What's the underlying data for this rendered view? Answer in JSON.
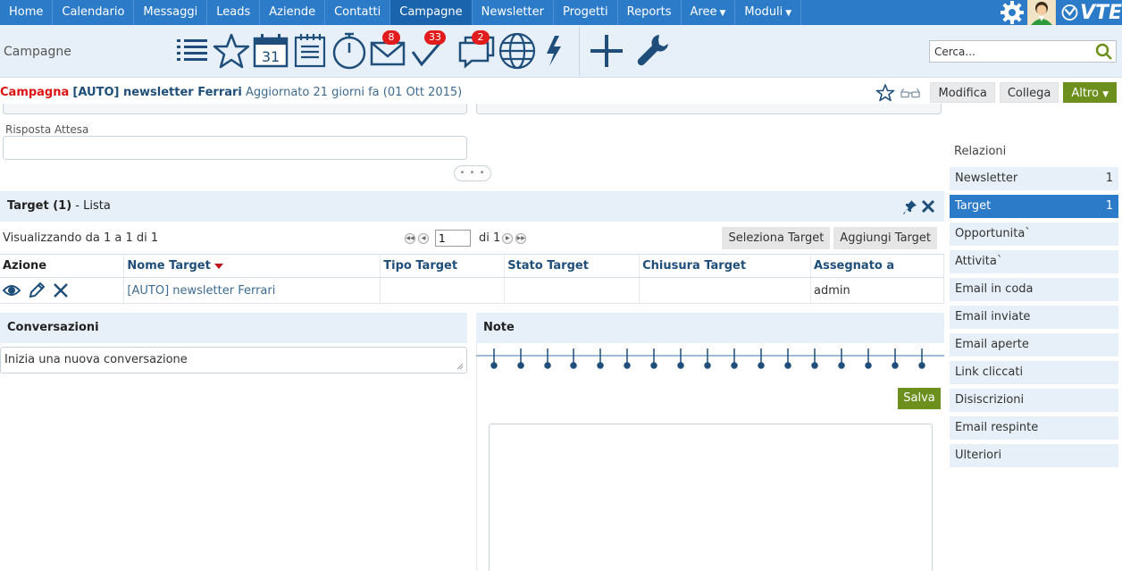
{
  "nav": {
    "items": [
      {
        "label": "Home",
        "active": false,
        "caret": false
      },
      {
        "label": "Calendario",
        "active": false,
        "caret": false
      },
      {
        "label": "Messaggi",
        "active": false,
        "caret": false
      },
      {
        "label": "Leads",
        "active": false,
        "caret": false
      },
      {
        "label": "Aziende",
        "active": false,
        "caret": false
      },
      {
        "label": "Contatti",
        "active": false,
        "caret": false
      },
      {
        "label": "Campagne",
        "active": true,
        "caret": false
      },
      {
        "label": "Newsletter",
        "active": false,
        "caret": false
      },
      {
        "label": "Progetti",
        "active": false,
        "caret": false
      },
      {
        "label": "Reports",
        "active": false,
        "caret": false
      },
      {
        "label": "Aree",
        "active": false,
        "caret": true
      },
      {
        "label": "Moduli",
        "active": false,
        "caret": true
      }
    ],
    "logo_text": "VTE",
    "right_icons": [
      "gear-icon",
      "user-avatar-icon",
      "vte-logo-icon"
    ]
  },
  "toolbar": {
    "module_name": "Campagne",
    "icons": [
      {
        "name": "list-icon",
        "badge": ""
      },
      {
        "name": "favorites-star-icon",
        "badge": ""
      },
      {
        "name": "calendar-icon",
        "badge": "",
        "text": "31"
      },
      {
        "name": "notebook-icon",
        "badge": ""
      },
      {
        "name": "stopwatch-icon",
        "badge": ""
      },
      {
        "name": "mail-icon",
        "badge": "8"
      },
      {
        "name": "todo-check-icon",
        "badge": "33"
      },
      {
        "name": "chat-icon",
        "badge": "2"
      },
      {
        "name": "globe-icon",
        "badge": ""
      },
      {
        "name": "lightning-icon",
        "badge": ""
      },
      {
        "name": "add-plus-icon",
        "badge": ""
      },
      {
        "name": "wrench-icon",
        "badge": ""
      }
    ],
    "search_placeholder": "Cerca..."
  },
  "record": {
    "module": "Campagna",
    "name": "[AUTO] newsletter Ferrari",
    "updated": "Aggiornato 21 giorni fa (01 Ott 2015)",
    "buttons": {
      "modifica": "Modifica",
      "collega": "Collega",
      "altro": "Altro"
    }
  },
  "form": {
    "risposta_label": "Risposta Attesa",
    "risposta_value": ""
  },
  "target_block": {
    "title_bold": "Target (1)",
    "title_rest": " - Lista",
    "visualizzando": "Visualizzando da 1 a 1 di 1",
    "page_value": "1",
    "page_of": "di 1",
    "btn_seleziona": "Seleziona Target",
    "btn_aggiungi": "Aggiungi Target",
    "columns": [
      "Azione",
      "Nome Target",
      "Tipo Target",
      "Stato Target",
      "Chiusura Target",
      "Assegnato a"
    ],
    "rows": [
      {
        "nome": "[AUTO] newsletter Ferrari",
        "tipo": "",
        "stato": "",
        "chiusura": "",
        "assegnato": "admin"
      }
    ]
  },
  "conversazioni": {
    "title": "Conversazioni",
    "placeholder": "Inizia una nuova conversazione"
  },
  "note": {
    "title": "Note",
    "save_label": "Salva"
  },
  "related": {
    "title": "Relazioni",
    "items": [
      {
        "label": "Newsletter",
        "count": "1",
        "active": false
      },
      {
        "label": "Target",
        "count": "1",
        "active": true
      },
      {
        "label": "Opportunita`",
        "count": "",
        "active": false
      },
      {
        "label": "Attivita`",
        "count": "",
        "active": false
      },
      {
        "label": "Email in coda",
        "count": "",
        "active": false
      },
      {
        "label": "Email inviate",
        "count": "",
        "active": false
      },
      {
        "label": "Email aperte",
        "count": "",
        "active": false
      },
      {
        "label": "Link cliccati",
        "count": "",
        "active": false
      },
      {
        "label": "Disiscrizioni",
        "count": "",
        "active": false
      },
      {
        "label": "Email respinte",
        "count": "",
        "active": false
      },
      {
        "label": "Ulteriori",
        "count": "",
        "active": false
      }
    ]
  },
  "colors": {
    "nav_blue": "#2b7bc9",
    "nav_active": "#1a64ae",
    "light_panel": "#e7f0f8",
    "accent_green": "#6d8f1e",
    "badge_red": "#e21c1c",
    "record_red": "#dd1111",
    "icon_blue": "#1f4e7a"
  }
}
